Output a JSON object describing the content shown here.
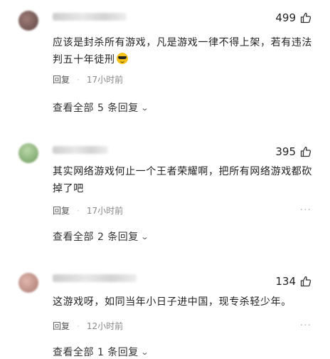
{
  "comments": [
    {
      "username": "",
      "likes": "499",
      "text": "应该是封杀所有游戏，凡是游戏一律不得上架，若有违法判五十年徒刑",
      "emoji": "sunglasses-emoji",
      "reply_label": "回复",
      "time": "17小时前",
      "view_replies": "查看全部 5 条回复",
      "avatar_color": "#8a6f6a"
    },
    {
      "username": "",
      "likes": "395",
      "text": "其实网络游戏何止一个王者荣耀啊，把所有网络游戏都砍掉了吧",
      "reply_label": "回复",
      "time": "17小时前",
      "view_replies": "查看全部 2 条回复",
      "avatar_color": "#7fa871"
    },
    {
      "username": "",
      "likes": "134",
      "text": "这游戏呀，如同当年小日子进中国，现专杀轻少年。",
      "reply_label": "回复",
      "time": "12小时前",
      "view_replies": "查看全部 1 条回复",
      "avatar_color": "#c79a91"
    }
  ],
  "icons": {
    "like": "thumbs-up-icon",
    "more": "more-dots-icon",
    "expand": "chevron-down-icon"
  }
}
